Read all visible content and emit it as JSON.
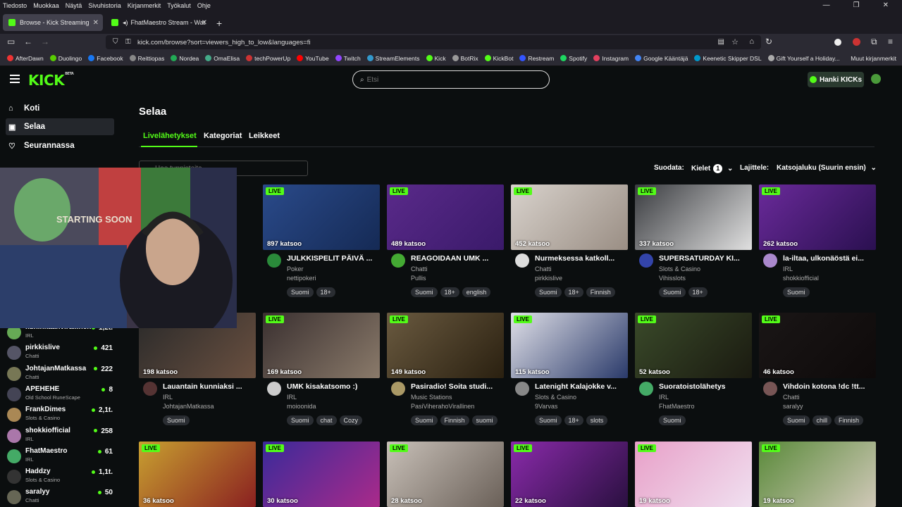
{
  "browser": {
    "menu": [
      "Tiedosto",
      "Muokkaa",
      "Näytä",
      "Sivuhistoria",
      "Kirjanmerkit",
      "Työkalut",
      "Ohje"
    ],
    "tabs": [
      {
        "label": "Browse - Kick Streaming"
      },
      {
        "label": "FhatMaestro Stream - Wat"
      }
    ],
    "new_tab": "+",
    "url": "kick.com/browse?sort=viewers_high_to_low&languages=fi",
    "bookmarks": [
      "AfterDawn",
      "Duolingo",
      "Facebook",
      "Reittiopas",
      "Nordea",
      "OmaElisa",
      "techPowerUp",
      "YouTube",
      "Twitch",
      "StreamElements",
      "Kick",
      "BotRix",
      "KickBot",
      "Restream",
      "Spotify",
      "Instagram",
      "Google Kääntäjä",
      "Keenetic Skipper DSL",
      "Gift Yourself a Holiday..."
    ],
    "other_bookmarks": "Muut kirjanmerkit",
    "window_controls": [
      "—",
      "❐",
      "✕"
    ],
    "icon_colors": {
      "kick": "#53fc18",
      "youtube": "#ff0000",
      "twitch": "#9146ff",
      "spotify": "#1ed760",
      "facebook": "#1877f2"
    }
  },
  "header": {
    "logo": "KICK",
    "logo_beta": "BETA",
    "search_placeholder": "Etsi",
    "kicks_button": "Hanki KICKs"
  },
  "sidebar": {
    "nav": [
      {
        "label": "Koti",
        "icon": "home-icon"
      },
      {
        "label": "Selaa",
        "icon": "browse-icon"
      },
      {
        "label": "Seurannassa",
        "icon": "heart-icon"
      }
    ],
    "following": [
      {
        "name": "kuninkaanvirallinen",
        "category": "IRL",
        "viewers": "1,2t."
      },
      {
        "name": "pirkkislive",
        "category": "Chatti",
        "viewers": "421"
      },
      {
        "name": "JohtajanMatkassa",
        "category": "Chatti",
        "viewers": "222"
      },
      {
        "name": "APEHEHE",
        "category": "Old School RuneScape",
        "viewers": "8"
      },
      {
        "name": "FrankDimes",
        "category": "Slots & Casino",
        "viewers": "2,1t."
      },
      {
        "name": "shokkiofficial",
        "category": "IRL",
        "viewers": "258"
      },
      {
        "name": "FhatMaestro",
        "category": "IRL",
        "viewers": "61"
      },
      {
        "name": "Haddzy",
        "category": "Slots & Casino",
        "viewers": "1,1t."
      },
      {
        "name": "saralyy",
        "category": "Chatti",
        "viewers": "50"
      }
    ]
  },
  "main": {
    "title": "Selaa",
    "tabs": [
      "Livelähetykset",
      "Kategoriat",
      "Leikkeet"
    ],
    "tag_search_placeholder": "Hae tunnisteita",
    "filter_label": "Suodata:",
    "languages_label": "Kielet",
    "languages_count": "1",
    "sort_label": "Lajittele:",
    "sort_value": "Katsojaluku (Suurin ensin)",
    "live_label": "LIVE",
    "streams": [
      {
        "views": "",
        "title": "",
        "category": "",
        "user": "",
        "tags": []
      },
      {
        "views": "897 katsoo",
        "title": "JULKKISPELIT PÄIVÄ ...",
        "category": "Poker",
        "user": "nettipokeri",
        "tags": [
          "Suomi",
          "18+"
        ]
      },
      {
        "views": "489 katsoo",
        "title": "REAGOIDAAN UMK ...",
        "category": "Chatti",
        "user": "Pullis",
        "tags": [
          "Suomi",
          "18+",
          "english"
        ]
      },
      {
        "views": "452 katsoo",
        "title": "Nurmeksessa katkoll...",
        "category": "Chatti",
        "user": "pirkkislive",
        "tags": [
          "Suomi",
          "18+",
          "Finnish"
        ]
      },
      {
        "views": "337 katsoo",
        "title": "SUPERSATURDAY KI...",
        "category": "Slots & Casino",
        "user": "Vihisslots",
        "tags": [
          "Suomi",
          "18+"
        ]
      },
      {
        "views": "262 katsoo",
        "title": "la-iltaa, ulkonäöstä ei...",
        "category": "IRL",
        "user": "shokkiofficial",
        "tags": [
          "Suomi"
        ]
      },
      {
        "views": "198 katsoo",
        "title": "Lauantain kunniaksi ...",
        "category": "IRL",
        "user": "JohtajanMatkassa",
        "tags": [
          "Suomi"
        ]
      },
      {
        "views": "169 katsoo",
        "title": "UMK kisakatsomo :)",
        "category": "IRL",
        "user": "moioonida",
        "tags": [
          "Suomi",
          "chat",
          "Cozy"
        ]
      },
      {
        "views": "149 katsoo",
        "title": "Pasiradio! Soita studi...",
        "category": "Music Stations",
        "user": "PasiViherahoVirallinen",
        "tags": [
          "Suomi",
          "Finnish",
          "suomi"
        ]
      },
      {
        "views": "115 katsoo",
        "title": "Latenight Kalajokke v...",
        "category": "Slots & Casino",
        "user": "9Varvas",
        "tags": [
          "Suomi",
          "18+",
          "slots"
        ]
      },
      {
        "views": "52 katsoo",
        "title": "Suoratoistolähetys",
        "category": "IRL",
        "user": "FhatMaestro",
        "tags": [
          "Suomi"
        ]
      },
      {
        "views": "46 katsoo",
        "title": "Vihdoin kotona !dc !tt...",
        "category": "Chatti",
        "user": "saralyy",
        "tags": [
          "Suomi",
          "chill",
          "Finnish"
        ]
      },
      {
        "views": "36 katsoo",
        "title": "",
        "category": "",
        "user": "",
        "tags": []
      },
      {
        "views": "30 katsoo",
        "title": "",
        "category": "",
        "user": "",
        "tags": []
      },
      {
        "views": "28 katsoo",
        "title": "",
        "category": "",
        "user": "",
        "tags": []
      },
      {
        "views": "22 katsoo",
        "title": "",
        "category": "",
        "user": "",
        "tags": []
      },
      {
        "views": "19 katsoo",
        "title": "",
        "category": "",
        "user": "",
        "tags": []
      },
      {
        "views": "19 katsoo",
        "title": "",
        "category": "",
        "user": "",
        "tags": []
      }
    ]
  },
  "overlay": {
    "webcam_sign": "STARTING SOON"
  },
  "colors": {
    "accent": "#53fc18",
    "background": "#0b0e0f",
    "tag_bg": "#2a2d32"
  }
}
